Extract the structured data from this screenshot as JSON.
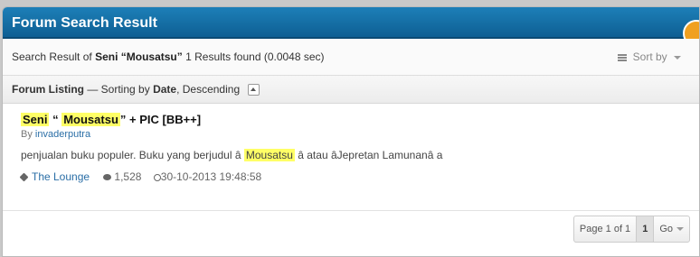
{
  "window": {
    "title": "Forum Search Result"
  },
  "summary": {
    "prefix": "Search Result of",
    "query_term1": "Seni",
    "query_term2": "“Mousatsu”",
    "results": "1 Results found (0.0048 sec)",
    "sort_label": "Sort by"
  },
  "listing": {
    "label": "Forum Listing",
    "dash": "— Sorting by",
    "sort_field": "Date",
    "sort_dir": ", Descending"
  },
  "result": {
    "title_term1": "Seni",
    "title_open_quote": "“",
    "title_term2": "Mousatsu",
    "title_rest": "” + PIC [BB++]",
    "by_label": "By",
    "author": "invaderputra",
    "snippet_before": "penjualan buku populer. Buku yang berjudul â",
    "snippet_highlight": "Mousatsu",
    "snippet_after": "â atau âJepretan Lamunanâ a",
    "forum": "The Lounge",
    "comments": "1,528",
    "datetime": "30-10-2013 19:48:58"
  },
  "pager": {
    "page_text": "Page 1 of 1",
    "current": "1",
    "go": "Go"
  },
  "colors": {
    "header_blue": "#0e5f93",
    "highlight": "#ffff66",
    "link": "#2a6ea6"
  },
  "icons": [
    "sort-list-icon",
    "collapse-icon",
    "tag-icon",
    "comment-icon",
    "clock-icon"
  ]
}
